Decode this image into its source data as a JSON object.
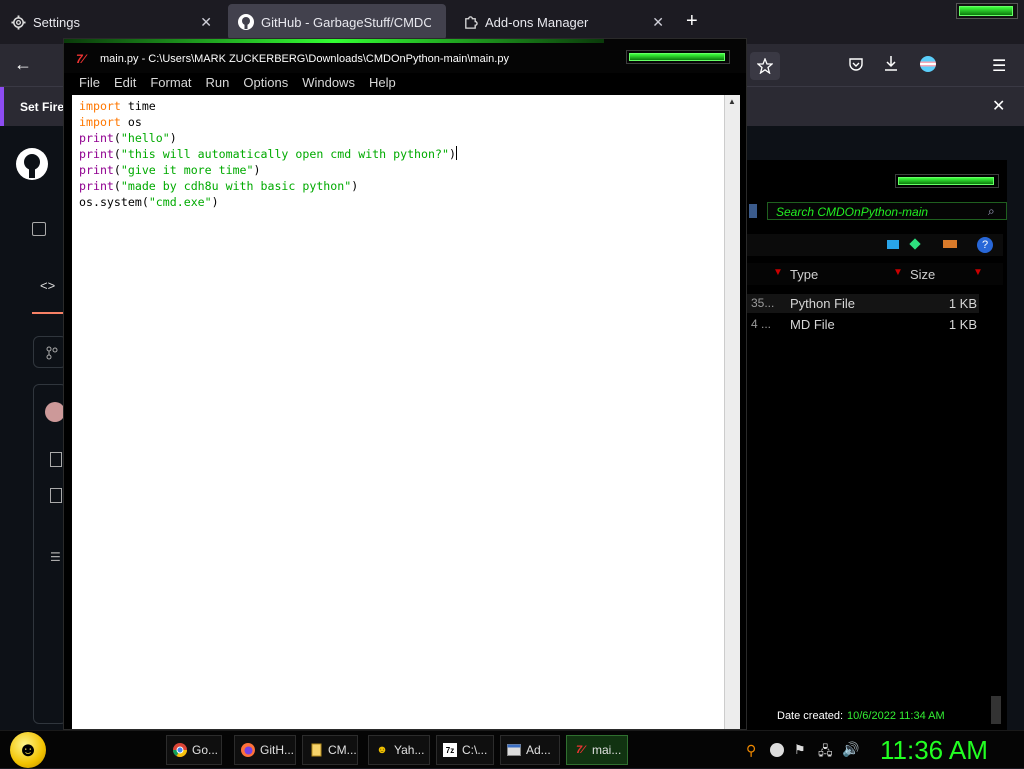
{
  "browser": {
    "tabs": [
      {
        "label": "Settings",
        "icon": "gear-icon"
      },
      {
        "label": "GitHub - GarbageStuff/CMDOn",
        "icon": "github-icon"
      },
      {
        "label": "Add-ons Manager",
        "icon": "puzzle-icon"
      }
    ],
    "new_tab_symbol": "+",
    "notification_text": "Set Fire"
  },
  "idle": {
    "title": "main.py - C:\\Users\\MARK ZUCKERBERG\\Downloads\\CMDOnPython-main\\main.py",
    "menu": [
      "File",
      "Edit",
      "Format",
      "Run",
      "Options",
      "Windows",
      "Help"
    ],
    "code_lines": [
      [
        {
          "t": "import",
          "c": "kw"
        },
        {
          "t": " time",
          "c": ""
        }
      ],
      [
        {
          "t": "import",
          "c": "kw"
        },
        {
          "t": " os",
          "c": ""
        }
      ],
      [
        {
          "t": "print",
          "c": "bi"
        },
        {
          "t": "(",
          "c": ""
        },
        {
          "t": "\"hello\"",
          "c": "st"
        },
        {
          "t": ")",
          "c": ""
        }
      ],
      [
        {
          "t": "print",
          "c": "bi"
        },
        {
          "t": "(",
          "c": ""
        },
        {
          "t": "\"this will automatically open cmd with python?\"",
          "c": "st"
        },
        {
          "t": ")",
          "c": ""
        }
      ],
      [
        {
          "t": "print",
          "c": "bi"
        },
        {
          "t": "(",
          "c": ""
        },
        {
          "t": "\"give it more time\"",
          "c": "st"
        },
        {
          "t": ")",
          "c": ""
        }
      ],
      [
        {
          "t": "print",
          "c": "bi"
        },
        {
          "t": "(",
          "c": ""
        },
        {
          "t": "\"made by cdh8u with basic python\"",
          "c": "st"
        },
        {
          "t": ")",
          "c": ""
        }
      ],
      [
        {
          "t": "os.system(",
          "c": ""
        },
        {
          "t": "\"cmd.exe\"",
          "c": "st"
        },
        {
          "t": ")",
          "c": ""
        }
      ]
    ]
  },
  "explorer": {
    "search_placeholder": "Search CMDOnPython-main",
    "columns": [
      "Type",
      "Size"
    ],
    "files": [
      {
        "date_fragment": "35...",
        "type": "Python File",
        "size": "1 KB"
      },
      {
        "date_fragment": "4 ...",
        "type": "MD File",
        "size": "1 KB"
      }
    ],
    "date_created_label": "Date created:",
    "date_created_value": "10/6/2022 11:34 AM"
  },
  "taskbar": {
    "buttons": [
      {
        "label": "Go...",
        "icon": "chrome-icon"
      },
      {
        "label": "GitH...",
        "icon": "firefox-icon"
      },
      {
        "label": "CM...",
        "icon": "folder-icon"
      },
      {
        "label": "Yah...",
        "icon": "yahoo-messenger-icon"
      },
      {
        "label": "C:\\...",
        "icon": "7zip-icon"
      },
      {
        "label": "Ad...",
        "icon": "window-icon"
      },
      {
        "label": "mai...",
        "icon": "python-idle-icon"
      }
    ],
    "clock": "11:36 AM"
  },
  "colors": {
    "accent_green": "#22ff22",
    "keyword": "#ff7700",
    "builtin": "#900090",
    "string": "#00aa00"
  }
}
